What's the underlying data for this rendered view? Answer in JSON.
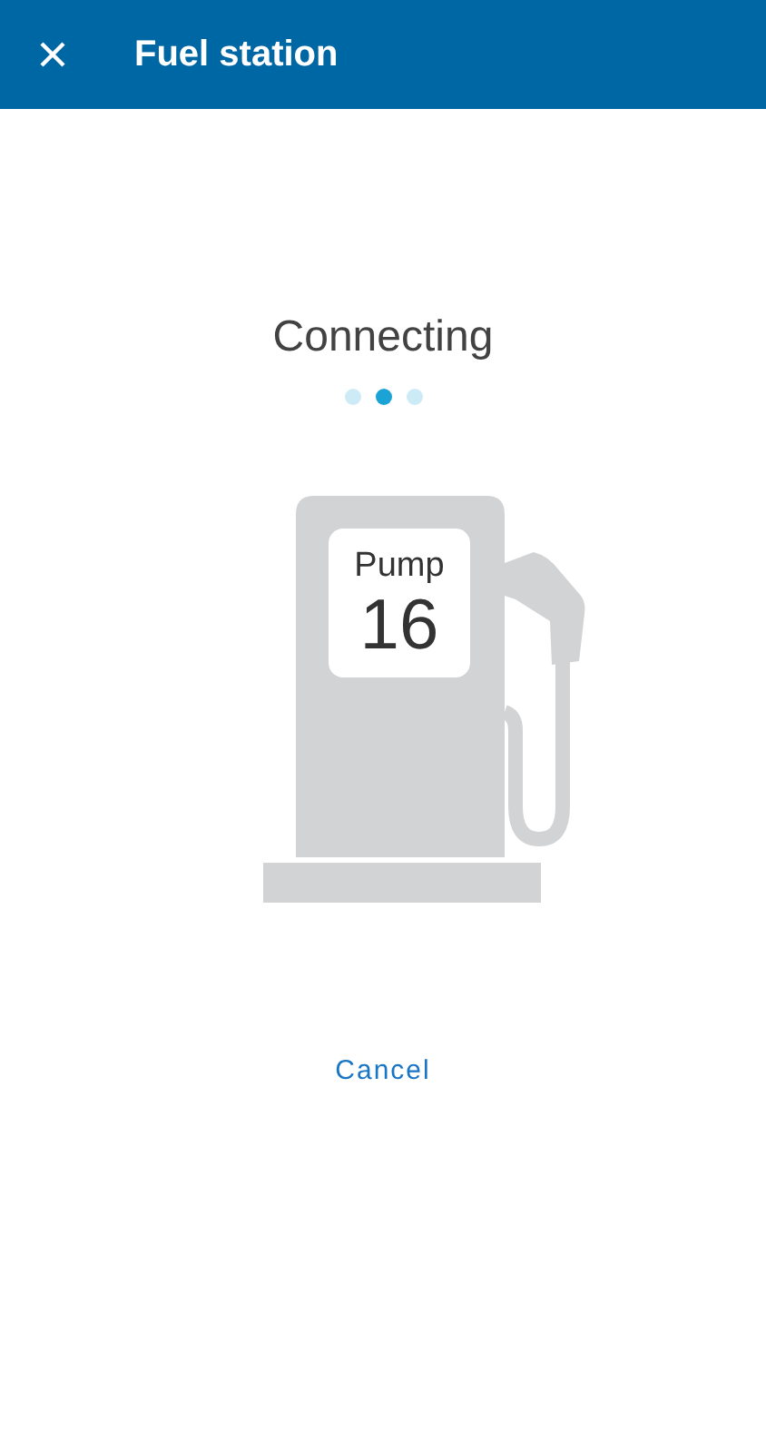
{
  "app_bar": {
    "title": "Fuel station"
  },
  "status": {
    "heading": "Connecting",
    "dots": [
      {
        "selected": false
      },
      {
        "selected": true
      },
      {
        "selected": false
      }
    ]
  },
  "pump": {
    "label": "Pump",
    "number": "16"
  },
  "cancel_button": "Cancel"
}
